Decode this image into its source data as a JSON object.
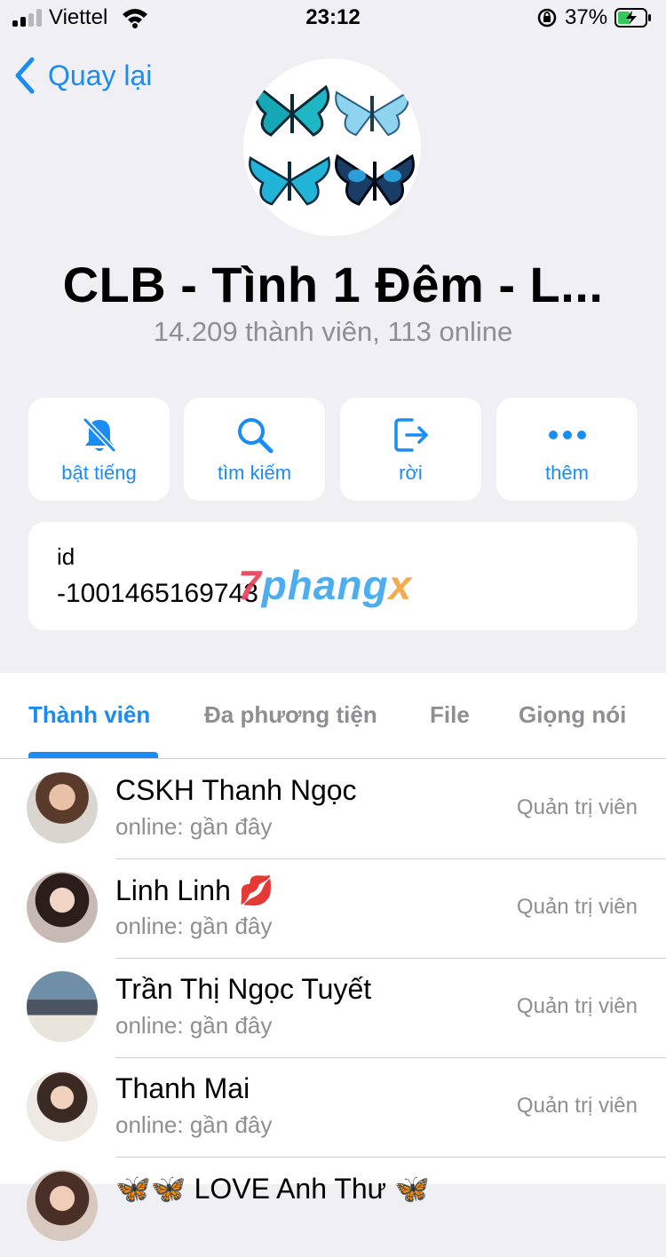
{
  "status_bar": {
    "carrier": "Viettel",
    "time": "23:12",
    "battery": "37%"
  },
  "header": {
    "back_label": "Quay lại",
    "title": "CLB - Tình 1 Đêm - L...",
    "subtitle": "14.209 thành viên, 113 online"
  },
  "actions": [
    {
      "label": "bật tiếng",
      "icon": "bell-slash-icon"
    },
    {
      "label": "tìm kiếm",
      "icon": "search-icon"
    },
    {
      "label": "rời",
      "icon": "leave-icon"
    },
    {
      "label": "thêm",
      "icon": "more-icon"
    }
  ],
  "info": {
    "id_label": "id",
    "id_value": "-1001465169743"
  },
  "watermark": {
    "seven": "7",
    "main": "phang",
    "x": "x"
  },
  "tabs": [
    "Thành viên",
    "Đa phương tiện",
    "File",
    "Giọng nói"
  ],
  "members": [
    {
      "name": "CSKH Thanh Ngọc",
      "status": "online: gần đây",
      "role": "Quản trị viên"
    },
    {
      "name": "Linh Linh 💋",
      "status": "online: gần đây",
      "role": "Quản trị viên"
    },
    {
      "name": "Trần Thị Ngọc Tuyết",
      "status": "online: gần đây",
      "role": "Quản trị viên"
    },
    {
      "name": "Thanh Mai",
      "status": "online: gần đây",
      "role": "Quản trị viên"
    },
    {
      "name": "🦋🦋 LOVE Anh Thư 🦋",
      "status": "",
      "role": ""
    }
  ],
  "colors": {
    "accent": "#1a8cf3",
    "background": "#efeff4",
    "secondary_text": "#8e8e93"
  }
}
